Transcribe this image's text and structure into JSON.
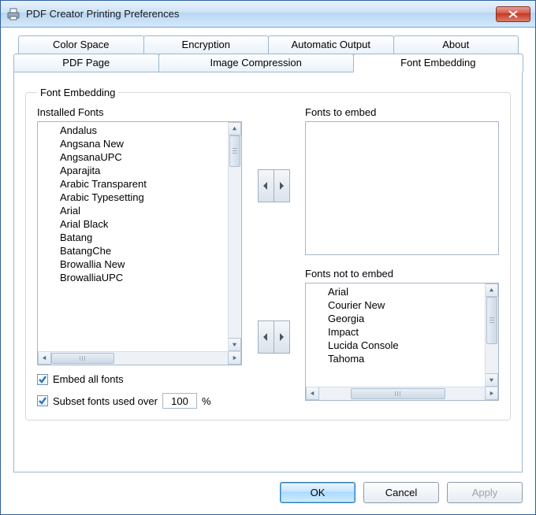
{
  "window": {
    "title": "PDF Creator Printing Preferences"
  },
  "tabs": {
    "row1": [
      {
        "label": "Color Space"
      },
      {
        "label": "Encryption"
      },
      {
        "label": "Automatic Output"
      },
      {
        "label": "About"
      }
    ],
    "row2": [
      {
        "label": "PDF Page"
      },
      {
        "label": "Image Compression"
      },
      {
        "label": "Font Embedding",
        "active": true
      }
    ]
  },
  "group": {
    "legend": "Font Embedding"
  },
  "labels": {
    "installed": "Installed Fonts",
    "to_embed": "Fonts to embed",
    "not_embed": "Fonts not to embed",
    "embed_all": "Embed all fonts",
    "subset": "Subset fonts used over",
    "percent": "%"
  },
  "installed_fonts": [
    "Andalus",
    "Angsana New",
    "AngsanaUPC",
    "Aparajita",
    "Arabic Transparent",
    "Arabic Typesetting",
    "Arial",
    "Arial Black",
    "Batang",
    "BatangChe",
    "Browallia New",
    "BrowalliaUPC"
  ],
  "fonts_to_embed": [],
  "fonts_not_to_embed": [
    "Arial",
    "Courier New",
    "Georgia",
    "Impact",
    "Lucida Console",
    "Tahoma"
  ],
  "subset_value": "100",
  "footer": {
    "ok": "OK",
    "cancel": "Cancel",
    "apply": "Apply"
  }
}
